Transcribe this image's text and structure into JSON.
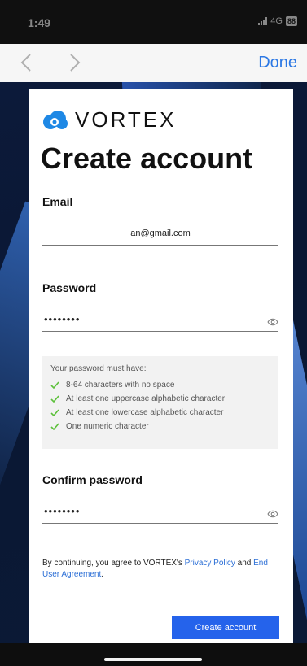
{
  "status_bar": {
    "time": "1:49",
    "network": "4G",
    "battery": "88"
  },
  "browser_nav": {
    "back_icon": "chevron-left-icon",
    "forward_icon": "chevron-right-icon",
    "done_label": "Done"
  },
  "brand": {
    "name": "VORTEX",
    "logo_icon": "cloud-logo-icon",
    "accent": "#1e88e5"
  },
  "form": {
    "title": "Create account",
    "email": {
      "label": "Email",
      "value": "an@gmail.com"
    },
    "password": {
      "label": "Password",
      "value": "••••••••",
      "toggle_icon": "eye-icon"
    },
    "requirements": {
      "heading": "Your password must have:",
      "items": [
        "8-64 characters with no space",
        "At least one uppercase alphabetic character",
        "At least one lowercase alphabetic character",
        "One numeric character"
      ],
      "check_color": "#5cc03a"
    },
    "confirm_password": {
      "label": "Confirm password",
      "value": "••••••••",
      "toggle_icon": "eye-icon"
    },
    "legal": {
      "prefix": "By continuing, you agree to VORTEX's ",
      "privacy_link": "Privacy Policy",
      "middle": " and ",
      "eua_link": "End User Agreement",
      "suffix": "."
    },
    "submit_label": "Create account",
    "submit_color": "#2563eb"
  }
}
